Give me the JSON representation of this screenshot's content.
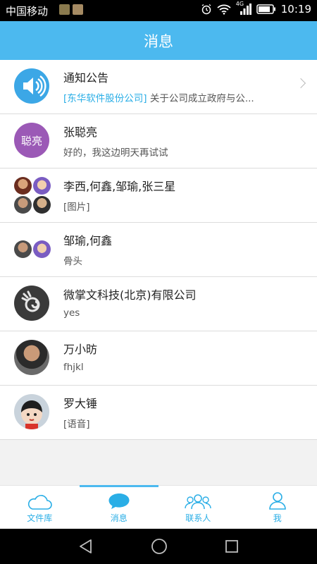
{
  "status_bar": {
    "carrier": "中国移动",
    "network": "4G",
    "time": "10:19"
  },
  "header": {
    "title": "消息"
  },
  "conversations": [
    {
      "name": "通知公告",
      "company": "[东华软件股份公司]",
      "preview": " 关于公司成立政府与公...",
      "avatar_icon": "speaker-icon",
      "avatar_color": "#3ca7e6"
    },
    {
      "name": "张聪亮",
      "preview": "好的，我这边明天再试试",
      "avatar_text": "聪亮",
      "avatar_color": "#9b59b6"
    },
    {
      "name": "李西,何鑫,邹瑜,张三星",
      "preview": "[图片]"
    },
    {
      "name": "邹瑜,何鑫",
      "preview": "骨头"
    },
    {
      "name": "微掌文科技(北京)有限公司",
      "preview": "yes"
    },
    {
      "name": "万小昉",
      "preview": "fhjkl"
    },
    {
      "name": "罗大锤",
      "preview": "[语音]"
    }
  ],
  "tabs": [
    {
      "label": "文件库",
      "icon": "cloud-icon"
    },
    {
      "label": "消息",
      "icon": "chat-bubble-icon",
      "active": true
    },
    {
      "label": "联系人",
      "icon": "contacts-icon"
    },
    {
      "label": "我",
      "icon": "person-icon"
    }
  ],
  "colors": {
    "accent": "#4cb9ef",
    "link": "#2aaee6",
    "avatar_purple": "#9b59b6"
  }
}
